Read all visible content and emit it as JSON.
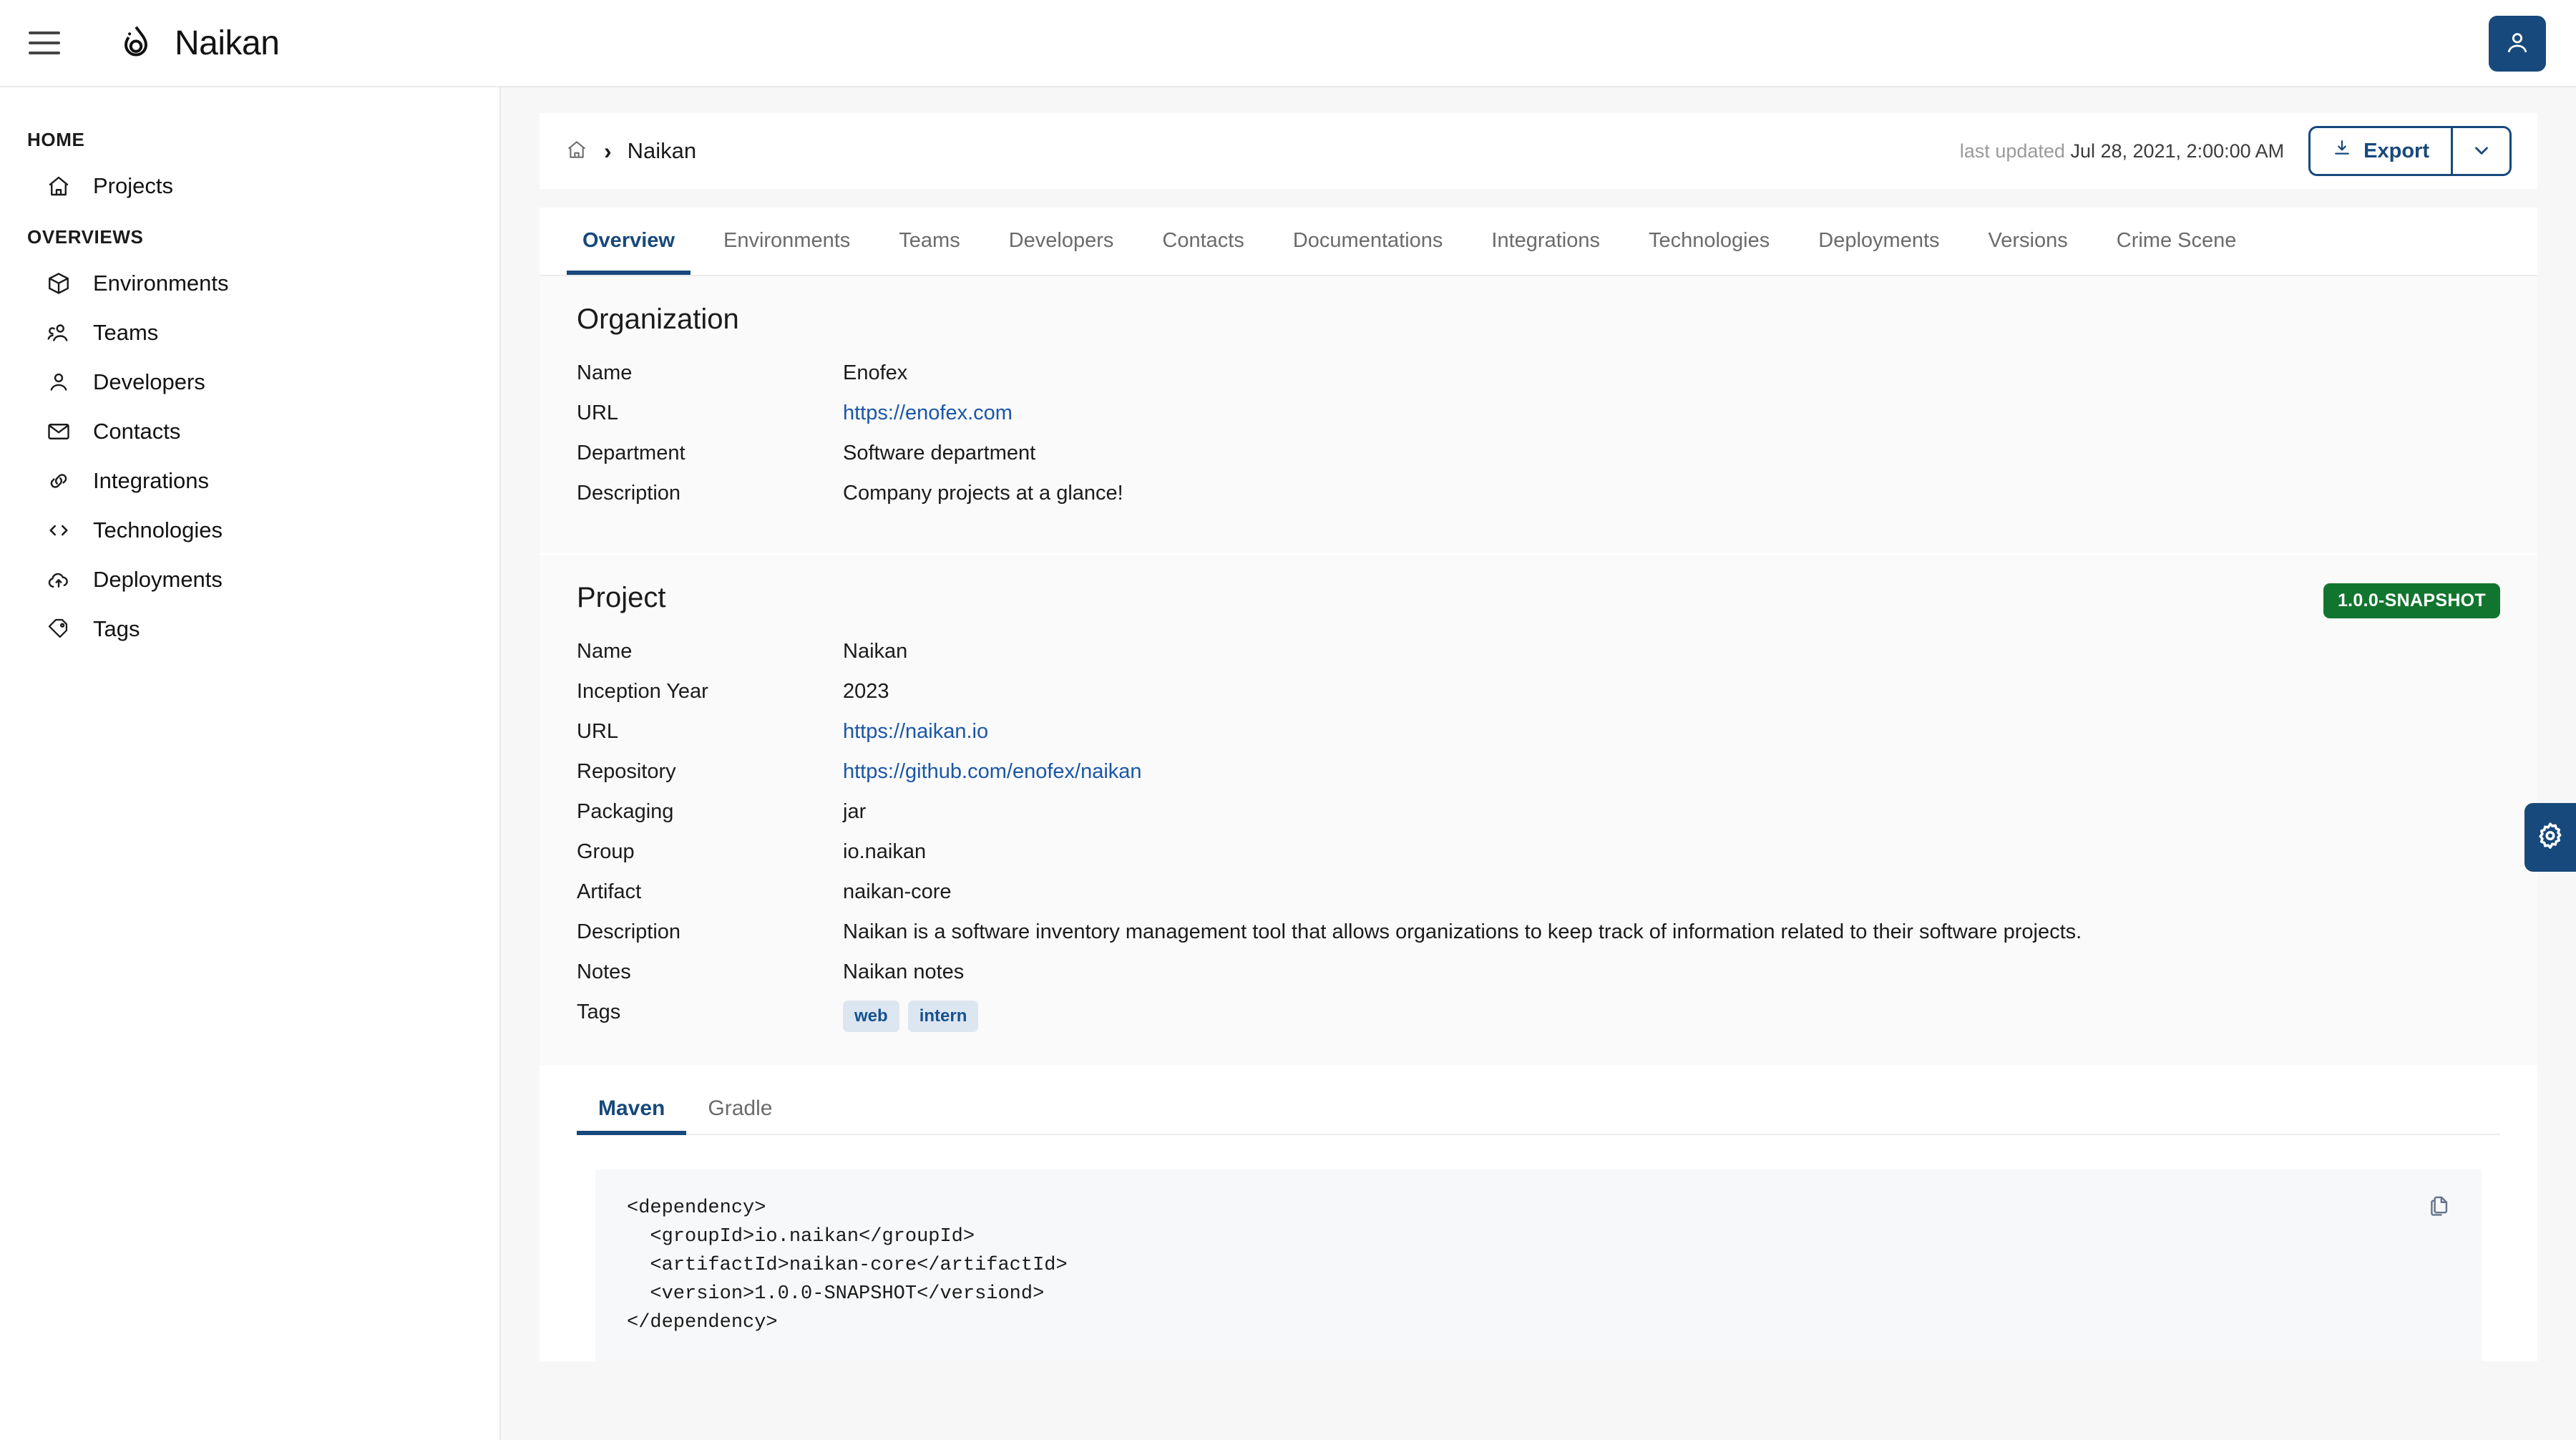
{
  "app": {
    "title": "Naikan"
  },
  "topbar": {
    "menu_icon": "hamburger-menu-icon",
    "logo_icon": "naikan-droplet-logo-icon",
    "user_icon": "user-account-icon"
  },
  "sidebar": {
    "groups": [
      {
        "heading": "HOME",
        "items": [
          {
            "label": "Projects",
            "icon": "home-icon"
          }
        ]
      },
      {
        "heading": "OVERVIEWS",
        "items": [
          {
            "label": "Environments",
            "icon": "cube-icon"
          },
          {
            "label": "Teams",
            "icon": "people-icon"
          },
          {
            "label": "Developers",
            "icon": "person-icon"
          },
          {
            "label": "Contacts",
            "icon": "envelope-icon"
          },
          {
            "label": "Integrations",
            "icon": "link-icon"
          },
          {
            "label": "Technologies",
            "icon": "code-brackets-icon"
          },
          {
            "label": "Deployments",
            "icon": "cloud-upload-icon"
          },
          {
            "label": "Tags",
            "icon": "tag-icon"
          }
        ]
      }
    ]
  },
  "breadcrumb": {
    "home_icon": "home-icon",
    "separator": "›",
    "current": "Naikan"
  },
  "header": {
    "last_updated_label": "last updated",
    "last_updated_value": "Jul 28, 2021, 2:00:00 AM",
    "export_label": "Export",
    "export_icon": "download-icon",
    "export_caret_icon": "chevron-down-icon"
  },
  "tabs": [
    {
      "label": "Overview",
      "active": true
    },
    {
      "label": "Environments",
      "active": false
    },
    {
      "label": "Teams",
      "active": false
    },
    {
      "label": "Developers",
      "active": false
    },
    {
      "label": "Contacts",
      "active": false
    },
    {
      "label": "Documentations",
      "active": false
    },
    {
      "label": "Integrations",
      "active": false
    },
    {
      "label": "Technologies",
      "active": false
    },
    {
      "label": "Deployments",
      "active": false
    },
    {
      "label": "Versions",
      "active": false
    },
    {
      "label": "Crime Scene",
      "active": false
    }
  ],
  "organization": {
    "title": "Organization",
    "rows": [
      {
        "key": "Name",
        "value": "Enofex",
        "type": "text"
      },
      {
        "key": "URL",
        "value": "https://enofex.com",
        "type": "link"
      },
      {
        "key": "Department",
        "value": "Software department",
        "type": "text"
      },
      {
        "key": "Description",
        "value": "Company projects at a glance!",
        "type": "text"
      }
    ]
  },
  "project": {
    "title": "Project",
    "version_badge": "1.0.0-SNAPSHOT",
    "rows": [
      {
        "key": "Name",
        "value": "Naikan",
        "type": "text"
      },
      {
        "key": "Inception Year",
        "value": "2023",
        "type": "text"
      },
      {
        "key": "URL",
        "value": "https://naikan.io",
        "type": "link"
      },
      {
        "key": "Repository",
        "value": "https://github.com/enofex/naikan",
        "type": "link"
      },
      {
        "key": "Packaging",
        "value": "jar",
        "type": "text"
      },
      {
        "key": "Group",
        "value": "io.naikan",
        "type": "text"
      },
      {
        "key": "Artifact",
        "value": "naikan-core",
        "type": "text"
      },
      {
        "key": "Description",
        "value": "Naikan is a software inventory management tool that allows organizations to keep track of information related to their software projects.",
        "type": "text"
      },
      {
        "key": "Notes",
        "value": "Naikan notes",
        "type": "text"
      },
      {
        "key": "Tags",
        "value": "",
        "type": "chips"
      }
    ],
    "tags": [
      "web",
      "intern"
    ]
  },
  "build": {
    "tabs": [
      {
        "label": "Maven",
        "active": true
      },
      {
        "label": "Gradle",
        "active": false
      }
    ],
    "copy_icon": "copy-icon",
    "snippet": "<dependency>\n  <groupId>io.naikan</groupId>\n  <artifactId>naikan-core</artifactId>\n  <version>1.0.0-SNAPSHOT</versiond>\n</dependency>"
  },
  "floating": {
    "settings_icon": "gear-icon"
  },
  "colors": {
    "accent": "#17497c",
    "link": "#1a56a8",
    "badge_green": "#12752f",
    "chip_bg": "#dce6f1",
    "page_bg": "#f7f7f7",
    "card_bg": "#fafafa"
  }
}
